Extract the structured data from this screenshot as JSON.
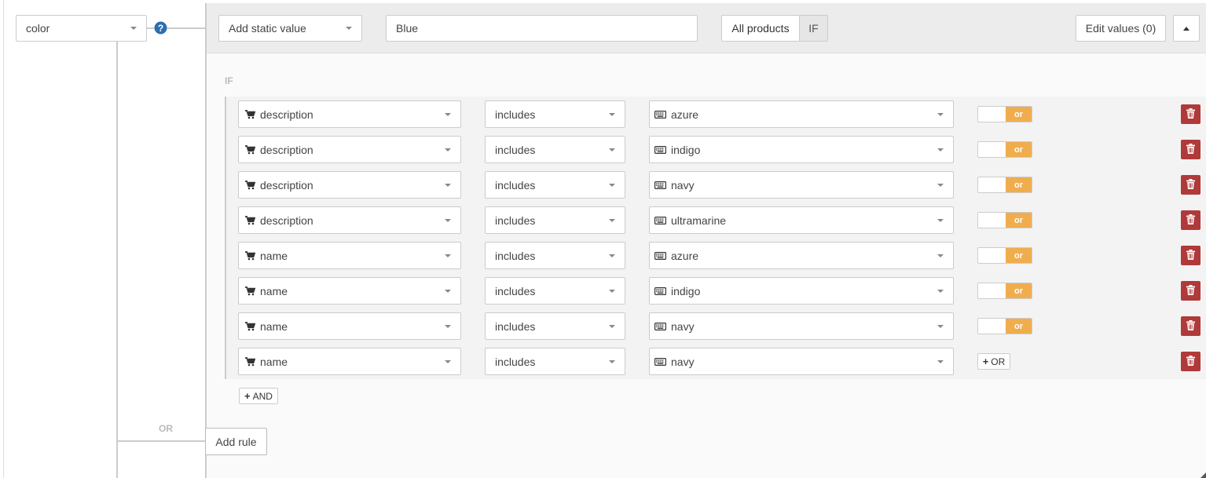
{
  "attribute": {
    "value": "color"
  },
  "rule": {
    "source_type": "Add static value",
    "static_value": "Blue",
    "scope_all_label": "All products",
    "scope_if_label": "IF",
    "edit_values_label": "Edit values (0)"
  },
  "conditions_header": "IF",
  "conditions": [
    {
      "field": "description",
      "operator": "includes",
      "value": "azure",
      "connector": "or"
    },
    {
      "field": "description",
      "operator": "includes",
      "value": "indigo",
      "connector": "or"
    },
    {
      "field": "description",
      "operator": "includes",
      "value": "navy",
      "connector": "or"
    },
    {
      "field": "description",
      "operator": "includes",
      "value": "ultramarine",
      "connector": "or"
    },
    {
      "field": "name",
      "operator": "includes",
      "value": "azure",
      "connector": "or"
    },
    {
      "field": "name",
      "operator": "includes",
      "value": "indigo",
      "connector": "or"
    },
    {
      "field": "name",
      "operator": "includes",
      "value": "navy",
      "connector": "or"
    },
    {
      "field": "name",
      "operator": "includes",
      "value": "navy",
      "connector": ""
    }
  ],
  "add_or_label": "OR",
  "add_and_label": "AND",
  "or_separator": "OR",
  "add_rule_label": "Add rule",
  "colors": {
    "accent_orange": "#f0ad4e",
    "delete_red": "#b03a3a",
    "help_blue": "#2a6fb0"
  },
  "icons": {
    "field": "cart-icon",
    "value": "keyboard-icon",
    "delete": "trash-icon",
    "help": "question-circle-icon",
    "collapse": "caret-up-icon"
  }
}
